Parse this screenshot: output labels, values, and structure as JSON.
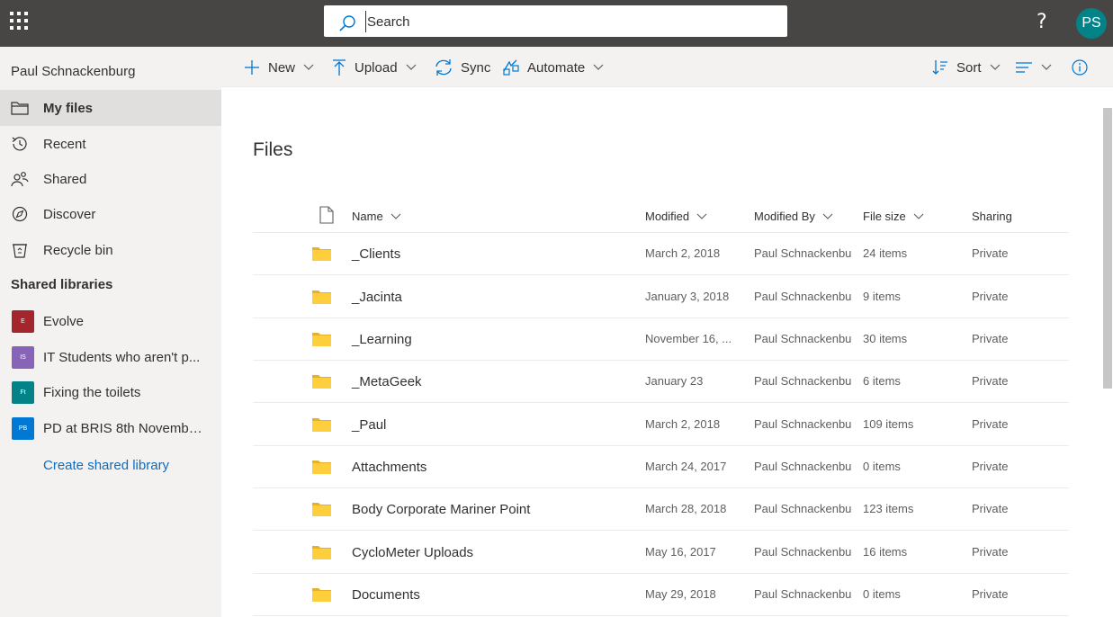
{
  "topbar": {
    "app_launcher_icon": "waffle-icon",
    "search_placeholder": "Search",
    "help_label": "?",
    "avatar_initials": "PS",
    "avatar_color": "#038387",
    "bar_color": "#484644"
  },
  "leftnav": {
    "user_name": "Paul Schnackenburg",
    "items": [
      {
        "label": "My files",
        "icon": "folder-icon",
        "selected": true
      },
      {
        "label": "Recent",
        "icon": "history-icon",
        "selected": false
      },
      {
        "label": "Shared",
        "icon": "people-icon",
        "selected": false
      },
      {
        "label": "Discover",
        "icon": "compass-icon",
        "selected": false
      },
      {
        "label": "Recycle bin",
        "icon": "recycle-bin-icon",
        "selected": false
      }
    ],
    "shared_libraries_title": "Shared libraries",
    "libraries": [
      {
        "label": "Evolve",
        "badge": "E",
        "color": "#a4262c"
      },
      {
        "label": "IT Students who aren't p...",
        "badge": "IS",
        "color": "#8764b8"
      },
      {
        "label": "Fixing the toilets",
        "badge": "Ft",
        "color": "#038387"
      },
      {
        "label": "PD at BRIS 8th Novembe...",
        "badge": "PB",
        "color": "#0078d4"
      }
    ],
    "create_library_label": "Create shared library"
  },
  "commandbar": {
    "new_label": "New",
    "upload_label": "Upload",
    "sync_label": "Sync",
    "automate_label": "Automate",
    "sort_label": "Sort",
    "view_icon": "view-options-icon",
    "info_icon": "info-icon"
  },
  "main": {
    "title": "Files",
    "columns": {
      "type_icon": "file-type-icon",
      "name": "Name",
      "modified": "Modified",
      "modified_by": "Modified By",
      "file_size": "File size",
      "sharing": "Sharing"
    },
    "rows": [
      {
        "name": "_Clients",
        "modified": "March 2, 2018",
        "modified_by": "Paul Schnackenburg",
        "file_size": "24 items",
        "sharing": "Private"
      },
      {
        "name": "_Jacinta",
        "modified": "January 3, 2018",
        "modified_by": "Paul Schnackenburg",
        "file_size": "9 items",
        "sharing": "Private"
      },
      {
        "name": "_Learning",
        "modified": "November 16, ...",
        "modified_by": "Paul Schnackenburg",
        "file_size": "30 items",
        "sharing": "Private"
      },
      {
        "name": "_MetaGeek",
        "modified": "January 23",
        "modified_by": "Paul Schnackenburg",
        "file_size": "6 items",
        "sharing": "Private"
      },
      {
        "name": "_Paul",
        "modified": "March 2, 2018",
        "modified_by": "Paul Schnackenburg",
        "file_size": "109 items",
        "sharing": "Private"
      },
      {
        "name": "Attachments",
        "modified": "March 24, 2017",
        "modified_by": "Paul Schnackenburg",
        "file_size": "0 items",
        "sharing": "Private"
      },
      {
        "name": "Body Corporate Mariner Point",
        "modified": "March 28, 2018",
        "modified_by": "Paul Schnackenburg",
        "file_size": "123 items",
        "sharing": "Private"
      },
      {
        "name": "CycloMeter Uploads",
        "modified": "May 16, 2017",
        "modified_by": "Paul Schnackenburg",
        "file_size": "16 items",
        "sharing": "Private"
      },
      {
        "name": "Documents",
        "modified": "May 29, 2018",
        "modified_by": "Paul Schnackenburg",
        "file_size": "0 items",
        "sharing": "Private"
      }
    ]
  },
  "colors": {
    "accent": "#0078d4",
    "link": "#0f6cbd",
    "folder": "#ffce3d",
    "nav_bg": "#f3f2f1",
    "selected_bg": "#e1dfdd"
  }
}
